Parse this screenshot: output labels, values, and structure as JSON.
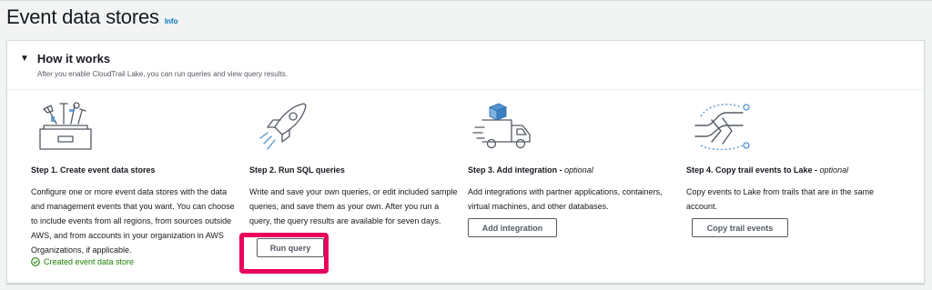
{
  "header": {
    "title": "Event data stores",
    "info_link": "Info"
  },
  "panel": {
    "title": "How it works",
    "description": "After you enable CloudTrail Lake, you can run queries and view query results."
  },
  "steps": [
    {
      "title": "Step 1. Create event data stores",
      "optional": "",
      "body": "Configure one or more event data stores with the data and management events that you want. You can choose to include events from all regions, from sources outside AWS, and from accounts in your organization in AWS Organizations, if applicable.",
      "status": "Created event data store",
      "icon": "toolbox-icon"
    },
    {
      "title": "Step 2. Run SQL queries",
      "optional": "",
      "body": "Write and save your own queries, or edit included sample queries, and save them as your own. After you run a query, the query results are available for seven days.",
      "button": "Run query",
      "icon": "rocket-icon"
    },
    {
      "title": "Step 3. Add integration - ",
      "optional": "optional",
      "body": "Add integrations with partner applications, containers, virtual machines, and other databases.",
      "button": "Add integration",
      "icon": "delivery-truck-icon"
    },
    {
      "title": "Step 4. Copy trail events to Lake - ",
      "optional": "optional",
      "body": "Copy events to Lake from trails that are in the same account.",
      "button": "Copy trail events",
      "icon": "merge-arrows-icon"
    }
  ],
  "colors": {
    "link": "#0073bb",
    "success": "#1d8102",
    "highlight": "#e8005c"
  }
}
